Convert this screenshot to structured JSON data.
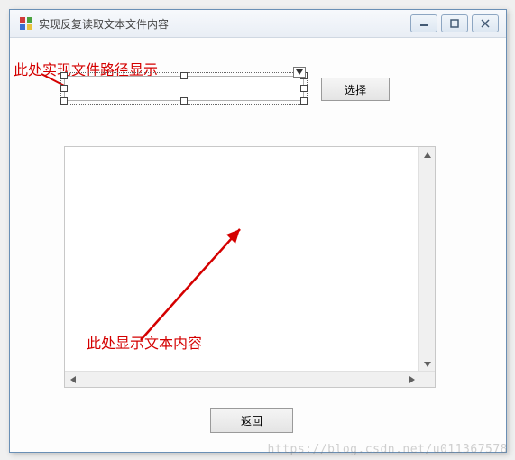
{
  "window": {
    "title": "实现反复读取文本文件内容"
  },
  "annotations": {
    "path_hint": "此处实现文件路径显示",
    "content_hint": "此处显示文本内容"
  },
  "path_input": {
    "value": "",
    "placeholder": ""
  },
  "buttons": {
    "select": "选择",
    "back": "返回"
  },
  "content_area": {
    "text": ""
  },
  "watermark": "https://blog.csdn.net/u011367578"
}
